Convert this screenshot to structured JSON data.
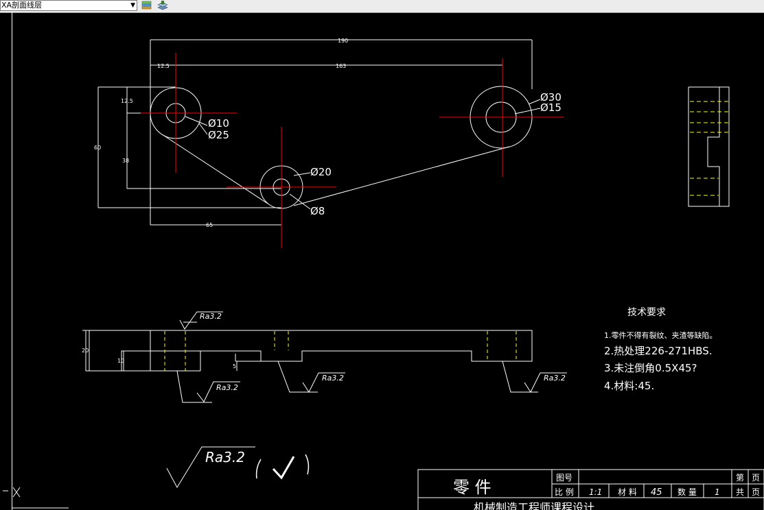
{
  "toolbar": {
    "layer_value": "XA剖面线层",
    "icons": [
      "layer-states-icon",
      "layer-previous-icon"
    ]
  },
  "colors": {
    "background": "#000000",
    "lines": "#ffffff",
    "centerlines": "#ff0000",
    "hidden_lines": "#ffff00"
  },
  "drawing": {
    "dims": {
      "d190": "190",
      "d12_5_top": "12.5",
      "d163": "163",
      "d12_5_left": "12.5",
      "d60": "60",
      "d38": "38",
      "d65": "65",
      "d20": "20",
      "d10": "10",
      "d5": "5"
    },
    "labels": {
      "phi10": "Ø10",
      "phi25": "Ø25",
      "phi20": "Ø20",
      "phi8": "Ø8",
      "phi30": "Ø30",
      "phi15": "Ø15"
    },
    "roughness": {
      "r1": "Ra3.2",
      "r2": "Ra3.2",
      "r3": "Ra3.2",
      "r4": "Ra3.2",
      "big": "Ra3.2"
    },
    "tech": {
      "title": "技术要求",
      "item1": "1.零件不得有裂纹、夹渣等缺陷。",
      "item2": "2.热处理226-271HBS.",
      "item3": "3.未注倒角0.5X45?",
      "item4": "4.材料:45."
    },
    "titleblock": {
      "name": "零    件",
      "tuhao": "图号",
      "bili_label": "比 例",
      "bili_value": "1:1",
      "cailiao_label": "材 料",
      "cailiao_value": "45",
      "shuliang_label": "数 量",
      "shuliang_value": "1",
      "di_label": "第",
      "gong_label": "共",
      "ye1": "页",
      "ye2": "页",
      "bottom_text": "机械制造工程师课程设计"
    }
  }
}
